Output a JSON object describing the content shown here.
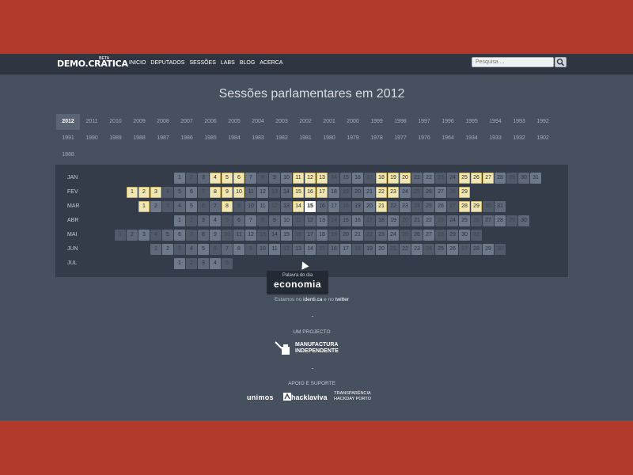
{
  "nav": {
    "logo": "DEMO.CRATICA",
    "logo_sup": "BETA",
    "links": [
      "INICIO",
      "DEPUTADOS",
      "SESSÕES",
      "LABS",
      "BLOG",
      "ACERCA"
    ],
    "search_placeholder": "Pesquisa ...",
    "search_icon": "search-icon"
  },
  "title": "Sessões parlamentares em 2012",
  "years": {
    "selected": "2012",
    "row1": [
      "2012",
      "2011",
      "2010",
      "2009",
      "2008",
      "2007",
      "2006",
      "2005",
      "2004",
      "2003",
      "2002",
      "2001",
      "2000",
      "1999",
      "1998",
      "1997",
      "1996",
      "1995",
      "1994",
      "1993",
      "1992"
    ],
    "row2": [
      "1991",
      "1990",
      "1989",
      "1988",
      "1987",
      "1986",
      "1985",
      "1984",
      "1983",
      "1982",
      "1981",
      "1980",
      "1979",
      "1978",
      "1977",
      "1976",
      "1964",
      "1934",
      "1933",
      "1932",
      "1902"
    ],
    "row3": [
      "1888"
    ]
  },
  "calendar": {
    "months": [
      {
        "label": "JAN",
        "offset": 6,
        "days": 31,
        "sessions": [
          4,
          5,
          6,
          11,
          12,
          13,
          18,
          19,
          20,
          25,
          26,
          27
        ]
      },
      {
        "label": "FEV",
        "offset": 2,
        "days": 29,
        "sessions": [
          1,
          2,
          3,
          8,
          9,
          10,
          15,
          16,
          17,
          22,
          23,
          29
        ]
      },
      {
        "label": "MAR",
        "offset": 3,
        "days": 31,
        "sessions": [
          1,
          8,
          14,
          21,
          28,
          29
        ],
        "hover": 15
      },
      {
        "label": "ABR",
        "offset": 6,
        "days": 30,
        "sessions": []
      },
      {
        "label": "MAI",
        "offset": 1,
        "days": 31,
        "sessions": []
      },
      {
        "label": "JUN",
        "offset": 4,
        "days": 30,
        "sessions": []
      },
      {
        "label": "JUL",
        "offset": 6,
        "days": 5,
        "sessions": []
      }
    ]
  },
  "tooltip": {
    "small": "Palavra do dia",
    "big": "economia"
  },
  "footer": {
    "follow_prefix": "Estamos no",
    "follow_link1": "identi.ca",
    "follow_mid": "e no",
    "follow_link2": "twitter",
    "project_label": "UM PROJECTO",
    "project_name_1": "MANUFACTURA",
    "project_name_2": "INDEPENDENTE",
    "support_label": "APOIO E SUPORTE",
    "sponsor1": "unimos",
    "sponsor2": "hacklaviva",
    "sponsor3_1": "TRANSPARÊNCIA",
    "sponsor3_2": "HACKDAY PORTO"
  },
  "colors": {
    "background": "#b23a2c",
    "page": "#46505f",
    "navbar": "#2f3641",
    "session_day": "#f0e6b4"
  }
}
